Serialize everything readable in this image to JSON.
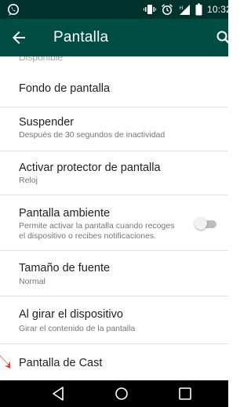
{
  "status_bar": {
    "time": "10:32",
    "icons": [
      "whatsapp-icon",
      "vibrate-icon",
      "alarm-icon",
      "signal-icon",
      "battery-icon"
    ]
  },
  "toolbar": {
    "title": "Pantalla",
    "back_icon": "back-arrow-icon",
    "search_icon": "search-icon"
  },
  "clipped_item_text": "Disponible",
  "settings": [
    {
      "title": "Fondo de pantalla",
      "subtitle": ""
    },
    {
      "title": "Suspender",
      "subtitle": "Después de 30 segundos de inactividad"
    },
    {
      "title": "Activar protector de pantalla",
      "subtitle": "Reloj"
    },
    {
      "title": "Pantalla ambiente",
      "subtitle_line1": "Permite activar la pantalla cuando recoges",
      "subtitle_line2": "el dispositivo o recibes notificaciones.",
      "toggle_on": false
    },
    {
      "title": "Tamaño de fuente",
      "subtitle": "Normal"
    },
    {
      "title": "Al girar el dispositivo",
      "subtitle": "Girar el contenido de la pantalla"
    },
    {
      "title": "Pantalla de Cast",
      "subtitle": ""
    }
  ],
  "nav_bar": {
    "back": "nav-back-icon",
    "home": "nav-home-icon",
    "recents": "nav-recents-icon"
  },
  "colors": {
    "status_bar": "#00332c",
    "toolbar": "#004d44",
    "annotation_arrow": "#e53935"
  }
}
